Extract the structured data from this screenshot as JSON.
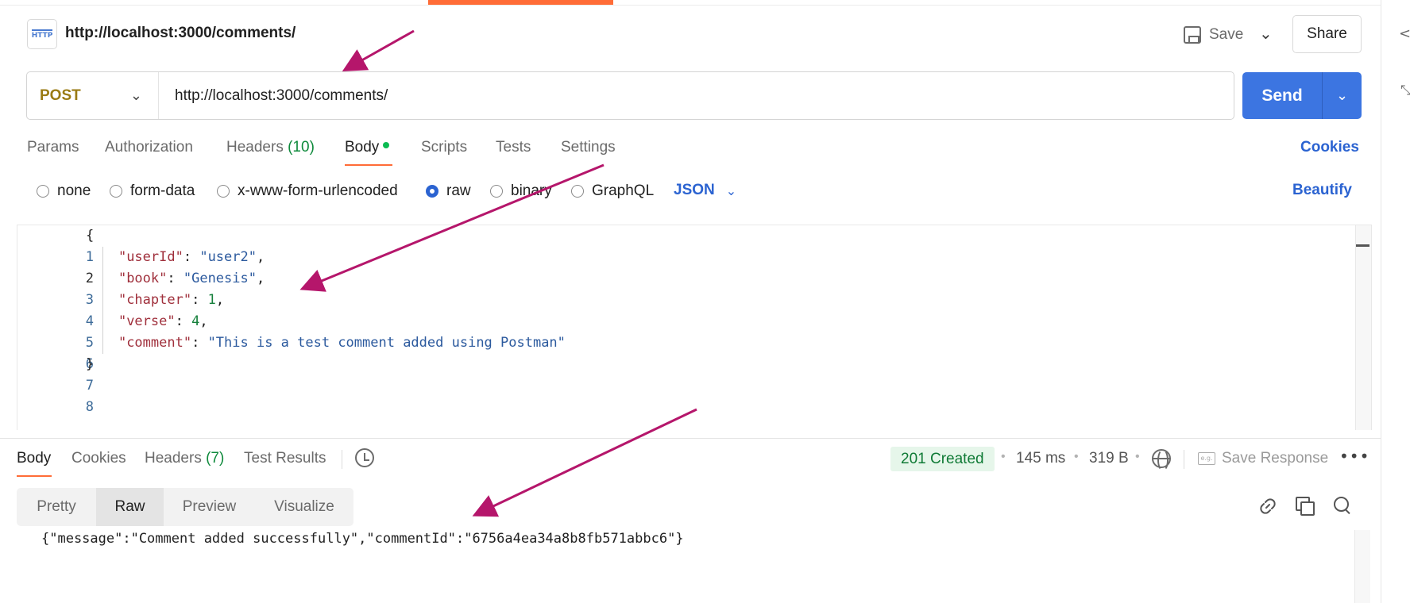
{
  "header": {
    "http_badge": "HTTP",
    "title": "http://localhost:3000/comments/",
    "save_label": "Save",
    "share_label": "Share"
  },
  "request": {
    "method": "POST",
    "url": "http://localhost:3000/comments/",
    "send_label": "Send"
  },
  "request_tabs": [
    {
      "label": "Params"
    },
    {
      "label": "Authorization"
    },
    {
      "label": "Headers",
      "count": "(10)"
    },
    {
      "label": "Body"
    },
    {
      "label": "Scripts"
    },
    {
      "label": "Tests"
    },
    {
      "label": "Settings"
    }
  ],
  "cookies_label": "Cookies",
  "body_types": [
    "none",
    "form-data",
    "x-www-form-urlencoded",
    "raw",
    "binary",
    "GraphQL"
  ],
  "body_type_selected": "raw",
  "format_label": "JSON",
  "beautify_label": "Beautify",
  "editor": {
    "line_numbers": [
      "1",
      "2",
      "3",
      "4",
      "5",
      "6",
      "7",
      "8"
    ],
    "lines": {
      "open_brace": "{",
      "userId_key": "\"userId\"",
      "userId_val": "\"user2\"",
      "book_key": "\"book\"",
      "book_val": "\"Genesis\"",
      "chapter_key": "\"chapter\"",
      "chapter_val": "1",
      "verse_key": "\"verse\"",
      "verse_val": "4",
      "comment_key": "\"comment\"",
      "comment_val": "\"This is a test comment added using Postman\"",
      "close_brace": "}"
    }
  },
  "response_tabs": [
    {
      "label": "Body"
    },
    {
      "label": "Cookies"
    },
    {
      "label": "Headers",
      "count": "(7)"
    },
    {
      "label": "Test Results"
    }
  ],
  "response_meta": {
    "status": "201 Created",
    "time": "145 ms",
    "size": "319 B",
    "save_response_label": "Save Response",
    "save_response_icon_text": "e.g."
  },
  "view_modes": [
    "Pretty",
    "Raw",
    "Preview",
    "Visualize"
  ],
  "view_mode_selected": "Raw",
  "response_body": "{\"message\":\"Comment added successfully\",\"commentId\":\"6756a4ea34a8b8fb571abbc6\"}",
  "colors": {
    "accent_orange": "#ff6c37",
    "send_blue": "#3c75e1",
    "link_blue": "#2b63d1",
    "method_gold": "#9a7b14",
    "status_green": "#0f7a35",
    "annotation_arrow": "#b5166b"
  },
  "icons": [
    "http-icon",
    "save-icon",
    "chevron-down-icon",
    "history-icon",
    "globe-icon",
    "save-response-icon",
    "more-icon",
    "link-icon",
    "copy-icon",
    "search-icon",
    "code-icon",
    "collapse-icon"
  ]
}
